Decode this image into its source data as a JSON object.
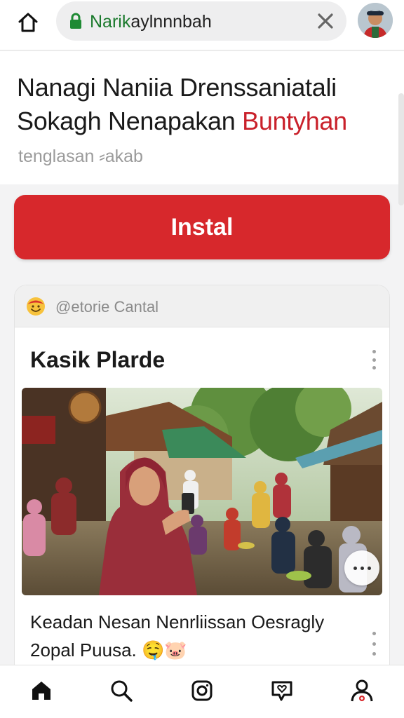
{
  "address_bar": {
    "url_domain": "Narik",
    "url_rest": "aylnnnbah",
    "lock_icon": "lock-icon",
    "clear_icon": "close-icon"
  },
  "page": {
    "title_line1": "Nanagi Naniia Drenssaniatali",
    "title_line2_plain": "Sokagh Nenapakan ",
    "title_line2_highlight": "Buntyhan",
    "subtitle": "tenglasan ⸗akab",
    "highlight_color": "#c9202a"
  },
  "install_button": {
    "label": "Instal",
    "color": "#d7282c"
  },
  "card": {
    "handle": "@etorie Cantal",
    "handle_icon": "smiley-emoji-icon",
    "title": "Kasik Plarde",
    "caption_line1": "Keadan Nesan Nenrliissan Oesragly",
    "caption_line2": "2opal Puusa.",
    "caption_emojis": "🤤🐷",
    "photo_description_icon": "village-market-photo",
    "more_icon": "more-horizontal-icon",
    "menu_icon": "more-vertical-icon"
  },
  "bottom_nav": {
    "items": [
      {
        "icon": "home-icon"
      },
      {
        "icon": "search-icon"
      },
      {
        "icon": "camera-icon"
      },
      {
        "icon": "chat-heart-icon"
      },
      {
        "icon": "profile-icon"
      }
    ]
  }
}
